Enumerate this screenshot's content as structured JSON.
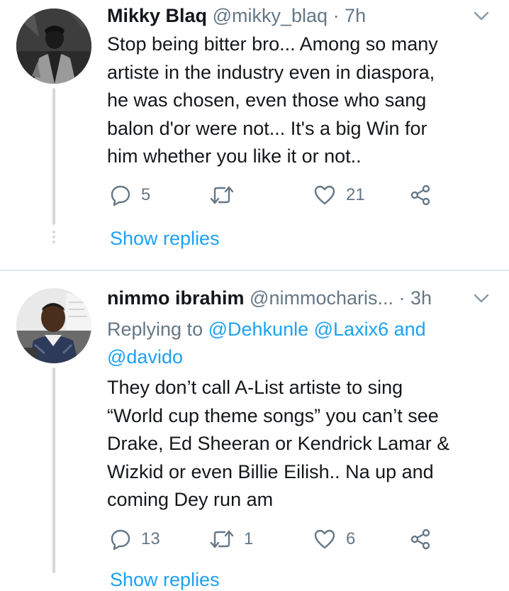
{
  "tweets": [
    {
      "name": "Mikky Blaq",
      "handle": "@mikky_blaq",
      "time": "· 7h",
      "body_lines": [
        "Stop being bitter bro... Among so many",
        "artiste in the industry even in diaspora,",
        "he was chosen, even those who sang",
        "balon d'or were not... It's a big Win for",
        "him whether you like it or not.."
      ],
      "reply_count": "5",
      "retweet_count": "",
      "like_count": "21",
      "show_replies": "Show replies"
    },
    {
      "name": "nimmo ibrahim",
      "handle": "@nimmocharis...",
      "time": "· 3h",
      "replying_prefix": "Replying to",
      "mentions": [
        "@Dehkunle",
        "@Laxix6",
        "@davido"
      ],
      "mention_joiner": "and",
      "body_lines": [
        "They don’t call A-List artiste to sing",
        "“World cup theme songs” you can’t see",
        "Drake, Ed Sheeran or Kendrick Lamar &",
        "Wizkid or even Billie Eilish.. Na up and",
        "coming Dey run am"
      ],
      "reply_count": "13",
      "retweet_count": "1",
      "like_count": "6",
      "show_replies": "Show replies"
    }
  ],
  "icons": {
    "reply": "speech-bubble-icon",
    "retweet": "retweet-arrows-icon",
    "like": "heart-outline-icon",
    "share": "share-nodes-icon",
    "more": "chevron-down-icon"
  },
  "colors": {
    "text": "#14171a",
    "secondary": "#657786",
    "link": "#1da1f2",
    "divider": "#e1e8ed",
    "thread_line": "#cfd9de"
  }
}
